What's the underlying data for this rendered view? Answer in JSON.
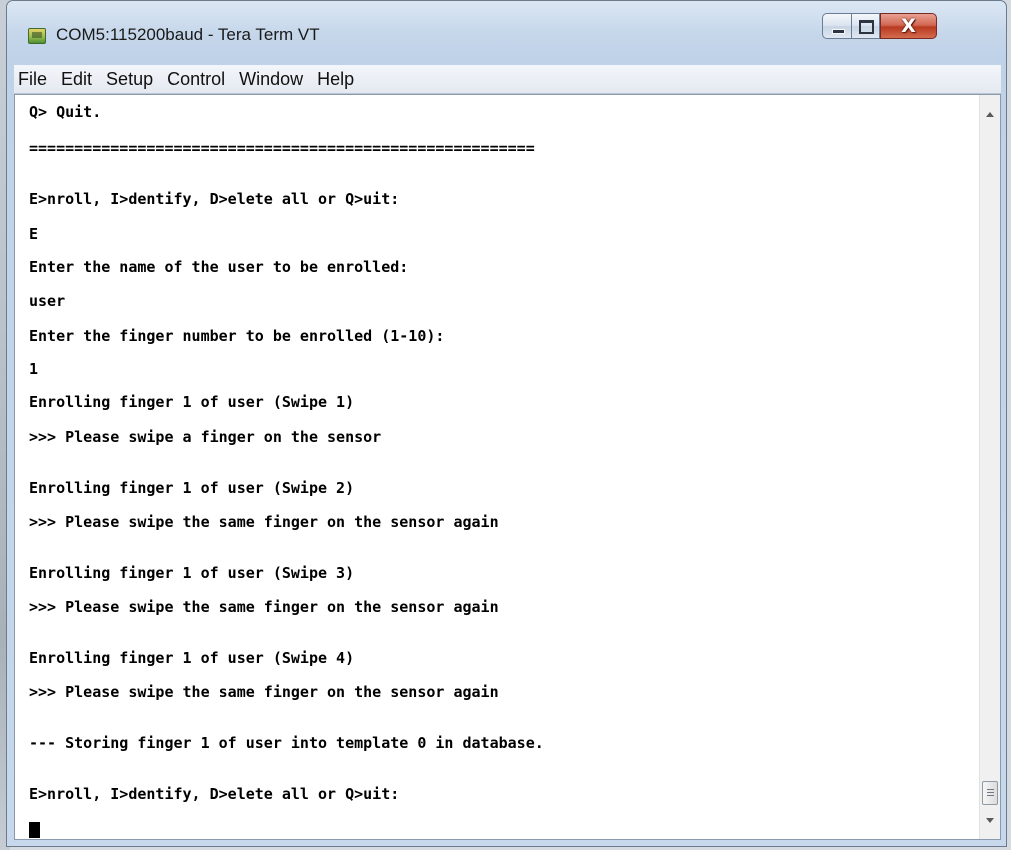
{
  "window": {
    "title": "COM5:115200baud - Tera Term VT",
    "icon": "teraterm-app-icon"
  },
  "caption_buttons": {
    "minimize_icon": "minimize-icon",
    "maximize_icon": "maximize-icon",
    "close_label": "X"
  },
  "menu": {
    "items": [
      "File",
      "Edit",
      "Setup",
      "Control",
      "Window",
      "Help"
    ]
  },
  "terminal": {
    "lines": [
      "Q> Quit.",
      "========================================================",
      "E>nroll, I>dentify, D>elete all or Q>uit:",
      "E",
      "Enter the name of the user to be enrolled:",
      "user",
      "Enter the finger number to be enrolled (1-10):",
      "1",
      "Enrolling finger 1 of user (Swipe 1)",
      ">>> Please swipe a finger on the sensor",
      "Enrolling finger 1 of user (Swipe 2)",
      ">>> Please swipe the same finger on the sensor again",
      "Enrolling finger 1 of user (Swipe 3)",
      ">>> Please swipe the same finger on the sensor again",
      "Enrolling finger 1 of user (Swipe 4)",
      ">>> Please swipe the same finger on the sensor again",
      "--- Storing finger 1 of user into template 0 in database.",
      "E>nroll, I>dentify, D>elete all or Q>uit:"
    ]
  }
}
